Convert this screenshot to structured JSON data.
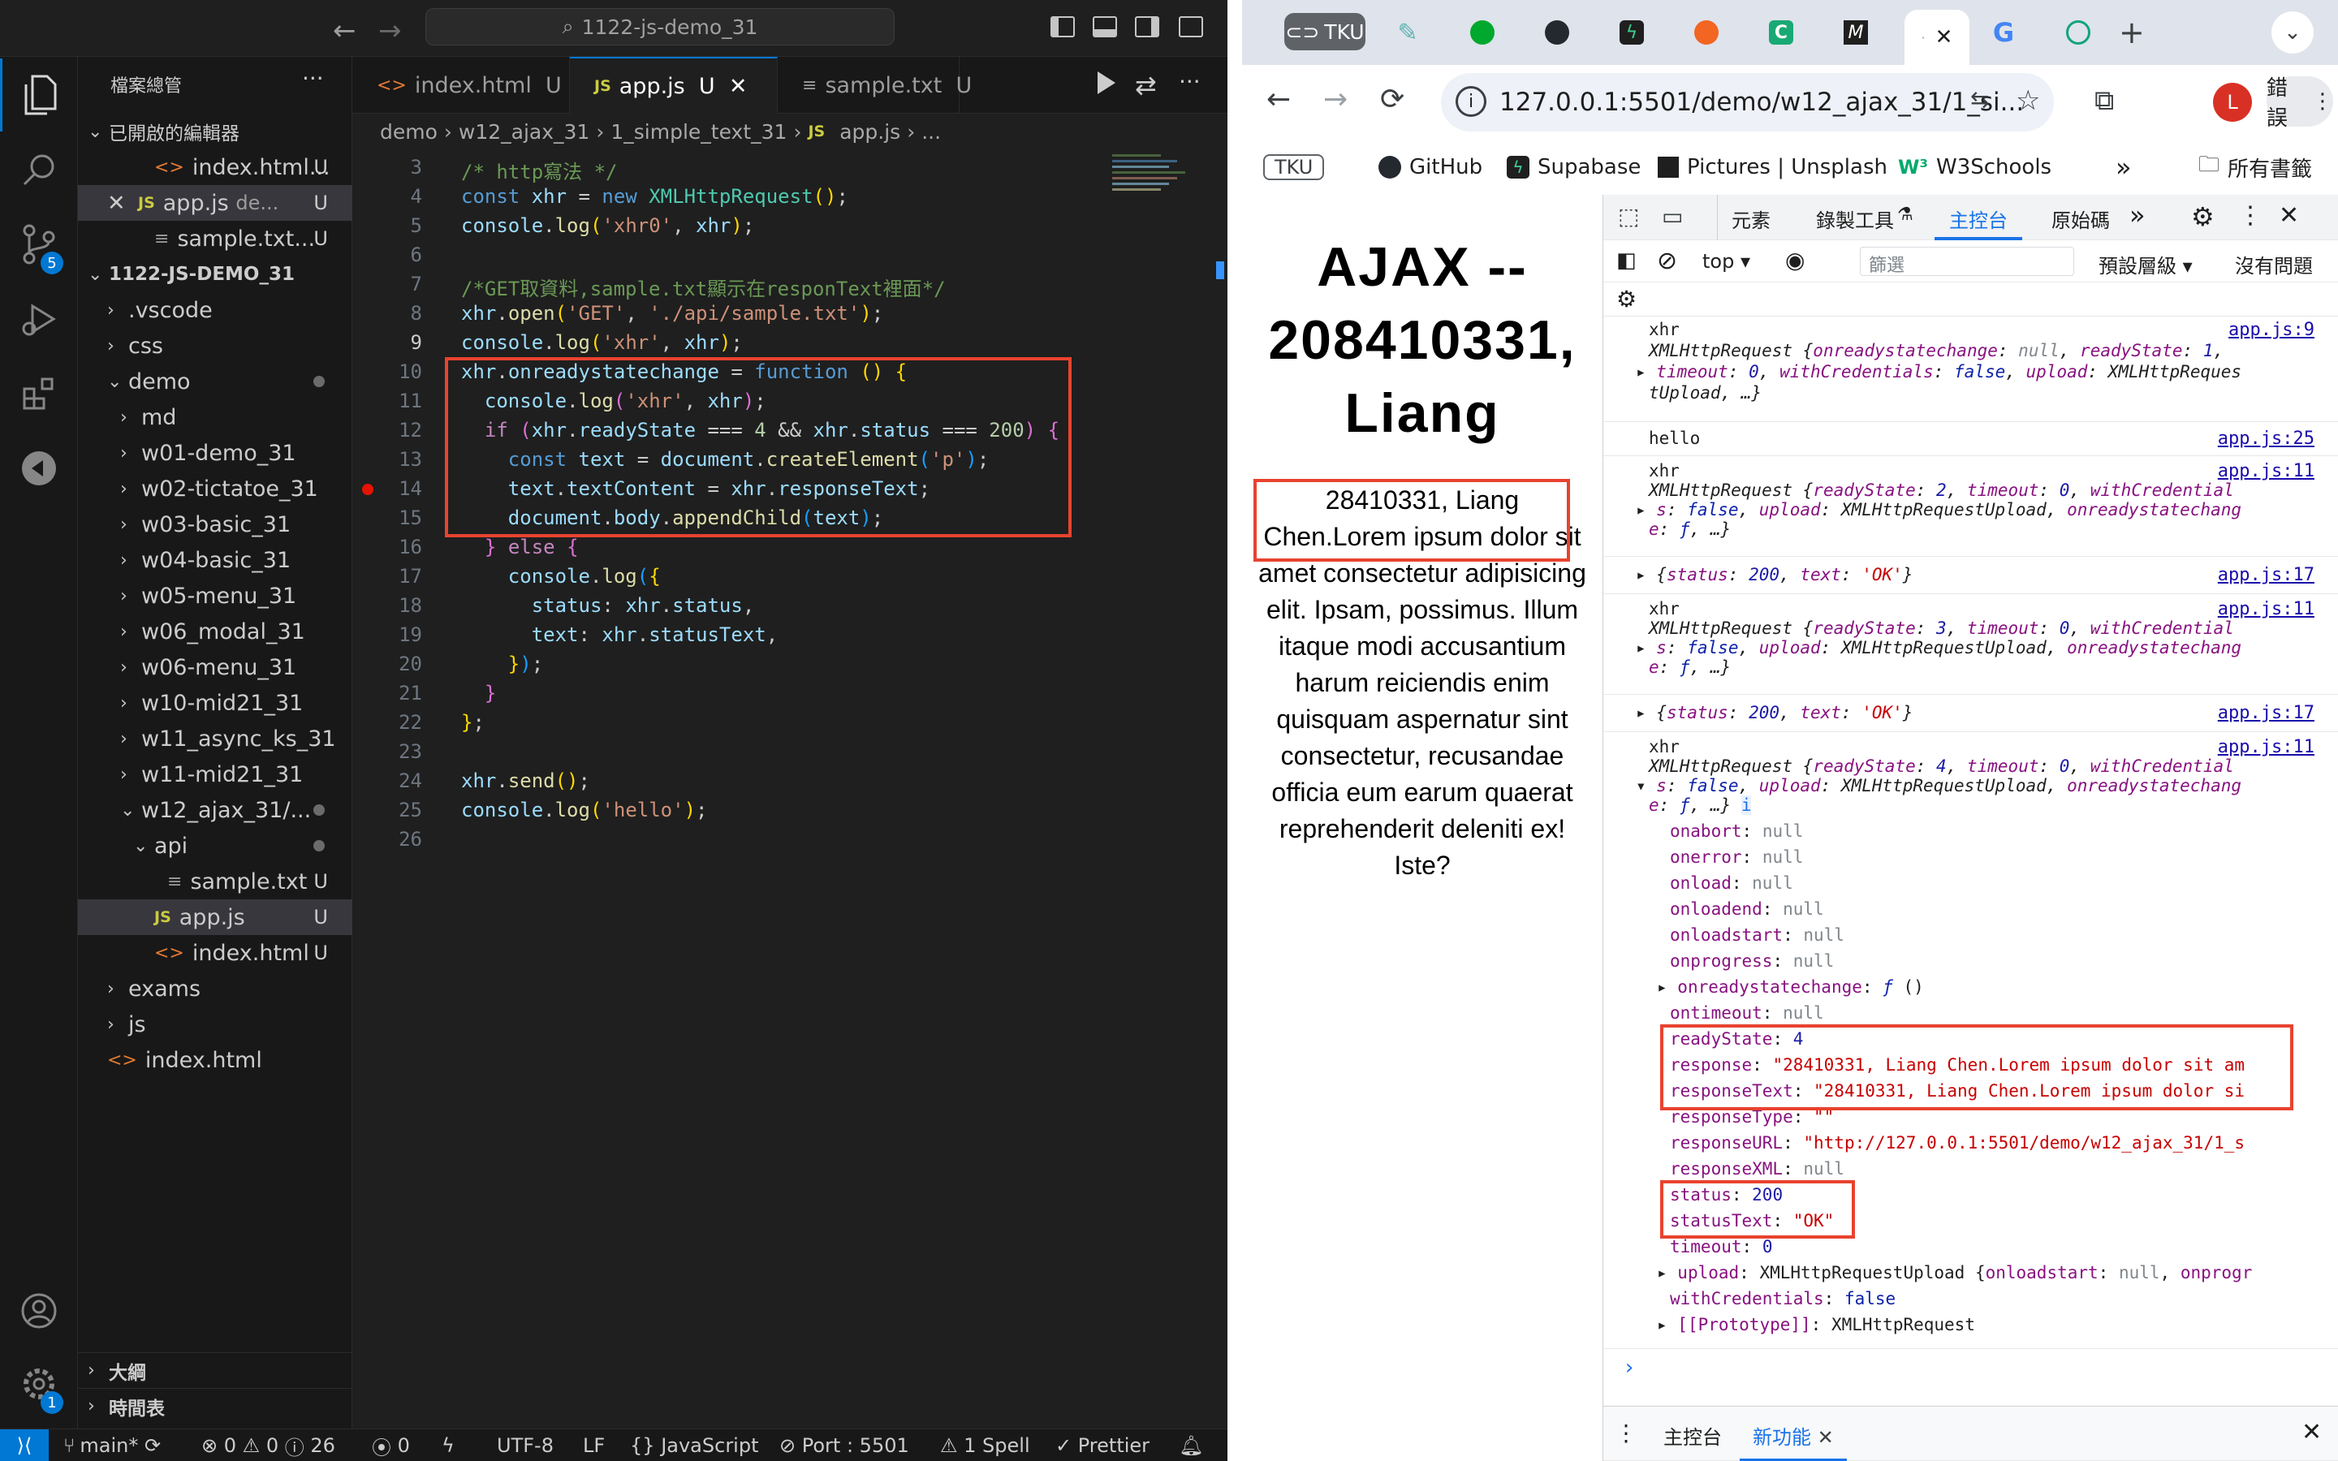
{
  "vscode": {
    "command_center": "1122-js-demo_31",
    "sidebar_title": "檔案總管",
    "open_editors_label": "已開啟的編輯器",
    "open_editors": [
      {
        "name": "index.html...",
        "badge": "U",
        "icon": "html"
      },
      {
        "name": "app.js",
        "desc": "de...",
        "badge": "U",
        "icon": "js"
      },
      {
        "name": "sample.txt...",
        "badge": "U",
        "icon": "txt"
      }
    ],
    "project_name": "1122-JS-DEMO_31",
    "tree": [
      {
        "label": ".vscode"
      },
      {
        "label": "css"
      },
      {
        "label": "demo"
      },
      {
        "label": "md"
      },
      {
        "label": "w01-demo_31"
      },
      {
        "label": "w02-tictatoe_31"
      },
      {
        "label": "w03-basic_31"
      },
      {
        "label": "w04-basic_31"
      },
      {
        "label": "w05-menu_31"
      },
      {
        "label": "w06_modal_31"
      },
      {
        "label": "w06-menu_31"
      },
      {
        "label": "w10-mid21_31"
      },
      {
        "label": "w11_async_ks_31"
      },
      {
        "label": "w11-mid21_31"
      },
      {
        "label": "w12_ajax_31/..."
      },
      {
        "label": "api"
      },
      {
        "label": "sample.txt",
        "badge": "U"
      },
      {
        "label": "app.js",
        "badge": "U"
      },
      {
        "label": "index.html",
        "badge": "U"
      },
      {
        "label": "exams"
      },
      {
        "label": "js"
      },
      {
        "label": "index.html"
      }
    ],
    "outline_label": "大綱",
    "timeline_label": "時間表",
    "tabs": [
      {
        "label": "index.html",
        "badge": "U"
      },
      {
        "label": "app.js",
        "badge": "U"
      },
      {
        "label": "sample.txt",
        "badge": "U"
      }
    ],
    "breadcrumb": [
      "demo",
      "w12_ajax_31",
      "1_simple_text_31",
      "app.js",
      "..."
    ],
    "line_numbers": [
      "3",
      "4",
      "5",
      "6",
      "7",
      "8",
      "9",
      "10",
      "11",
      "12",
      "13",
      "14",
      "15",
      "16",
      "17",
      "18",
      "19",
      "20",
      "21",
      "22",
      "23",
      "24",
      "25",
      "26"
    ],
    "code": {
      "l3": "/* http寫法 */",
      "l7": "/*GET取資料,sample.txt顯示在responText裡面*/",
      "s_xhr0": "'xhr0'",
      "s_get": "'GET'",
      "s_path": "'./api/sample.txt'",
      "s_xhr": "'xhr'",
      "s_p": "'p'",
      "s_hello": "'hello'",
      "n4": "4",
      "n200": "200"
    },
    "badges": {
      "scm": "5",
      "settings": "1"
    },
    "status": {
      "branch": "main*",
      "errors": "0",
      "warnings": "0",
      "info": "26",
      "ports": "0",
      "encoding": "UTF-8",
      "eol": "LF",
      "language": "JavaScript",
      "port": "Port : 5501",
      "spell": "1 Spell",
      "prettier": "Prettier"
    }
  },
  "chrome": {
    "first_tab": "TKU",
    "url": "127.0.0.1:5501/demo/w12_ajax_31/1_si...",
    "profile_initial": "L",
    "error_label": "錯誤",
    "bookmarks": [
      "TKU",
      "GitHub",
      "Supabase",
      "Pictures | Unsplash",
      "W3Schools"
    ],
    "all_bookmarks": "所有書籤",
    "page": {
      "heading": "AJAX -- 208410331, Liang",
      "body": "28410331, Liang Chen.Lorem ipsum dolor sit amet consectetur adipisicing elit. Ipsam, possimus. Illum itaque modi accusantium harum reiciendis enim quisquam aspernatur sint consectetur, recusandae officia eum earum quaerat reprehenderit deleniti ex! Iste?"
    },
    "devtools": {
      "tabs": [
        "元素",
        "錄製工具",
        "主控台",
        "原始碼"
      ],
      "context": "top",
      "filter_placeholder": "篩選",
      "levels": "預設層級",
      "issues": "沒有問題",
      "drawer_tabs": [
        "主控台",
        "新功能"
      ],
      "messages": [
        {
          "label": "xhr",
          "src": "app.js:9"
        },
        {
          "label": "hello",
          "src": "app.js:25"
        },
        {
          "label": "xhr",
          "src": "app.js:11"
        },
        {
          "label": "",
          "src": "app.js:17"
        },
        {
          "label": "xhr",
          "src": "app.js:11"
        },
        {
          "label": "",
          "src": "app.js:17"
        },
        {
          "label": "xhr",
          "src": "app.js:11"
        }
      ],
      "props": {
        "readyState": "4",
        "response": "\"28410331, Liang Chen.Lorem ipsum dolor sit am",
        "responseText": "\"28410331, Liang Chen.Lorem ipsum dolor si",
        "responseType": "\"\"",
        "responseURL": "\"http://127.0.0.1:5501/demo/w12_ajax_31/1_s",
        "status": "200",
        "statusText": "\"OK\"",
        "timeout": "0",
        "withCredentials": "false"
      }
    }
  }
}
